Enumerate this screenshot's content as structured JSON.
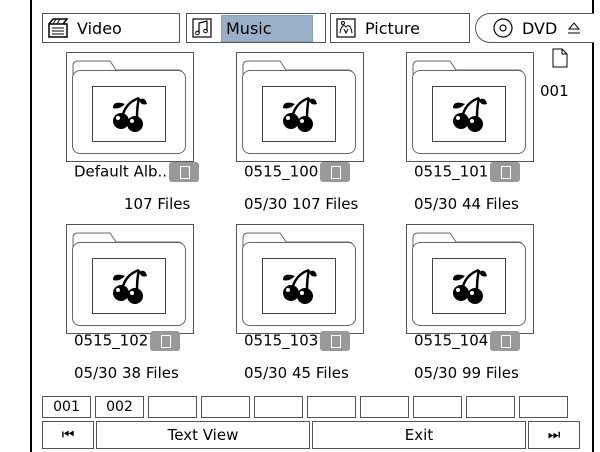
{
  "tabs": [
    {
      "label": "Video",
      "icon": "film-clapper-icon",
      "active": false
    },
    {
      "label": "Music",
      "icon": "music-note-icon",
      "active": true
    },
    {
      "label": "Picture",
      "icon": "picture-icon",
      "active": false
    },
    {
      "label": "DVD",
      "icon": "disc-icon",
      "active": false
    }
  ],
  "page_indicator": {
    "icon": "document-icon",
    "number": "001"
  },
  "albums": [
    {
      "name": "Default Alb..",
      "date": "",
      "count": "107 Files"
    },
    {
      "name": "0515_100",
      "date": "05/30",
      "count": "107 Files"
    },
    {
      "name": "0515_101",
      "date": "05/30",
      "count": "44  Files"
    },
    {
      "name": "0515_102",
      "date": "05/30",
      "count": "38  Files"
    },
    {
      "name": "0515_103",
      "date": "05/30",
      "count": "45 Files"
    },
    {
      "name": "0515_104",
      "date": "05/30",
      "count": "99 Files"
    }
  ],
  "pages": [
    "001",
    "002",
    "",
    "",
    "",
    "",
    "",
    "",
    "",
    ""
  ],
  "controls": {
    "prev": "⏮",
    "text_view": "Text View",
    "exit": "Exit",
    "next": "⏭"
  }
}
